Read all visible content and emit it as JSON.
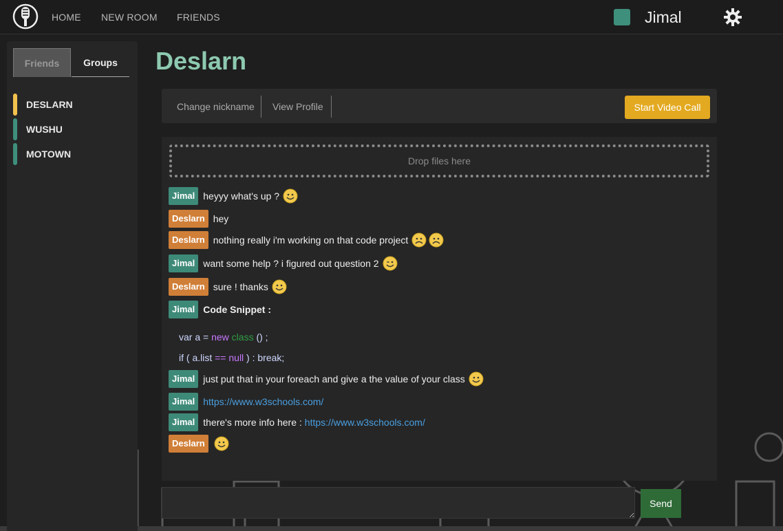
{
  "nav": {
    "home": "HOME",
    "new_room": "NEW ROOM",
    "friends": "FRIENDS",
    "username": "Jimal",
    "status_color": "#3e8f7c",
    "settings_icon": "gear-icon",
    "logo_icon": "microphone-icon"
  },
  "sidebar": {
    "tabs": [
      {
        "label": "Friends",
        "active": true
      },
      {
        "label": "Groups",
        "active": false
      }
    ],
    "friends": [
      {
        "name": "DESLARN",
        "color": "#f2c14e"
      },
      {
        "name": "WUSHU",
        "color": "#3e8f7c"
      },
      {
        "name": "MOTOWN",
        "color": "#3e8f7c"
      }
    ]
  },
  "room": {
    "title": "Deslarn",
    "toolbar": {
      "change_nickname": "Change nickname",
      "view_profile": "View Profile",
      "video_call": "Start Video Call"
    },
    "dropzone": "Drop files here",
    "send_label": "Send"
  },
  "messages": [
    {
      "sender": "Jimal",
      "text": "heyyy what's up ?",
      "emojis": [
        "smile"
      ]
    },
    {
      "sender": "Deslarn",
      "text": "hey",
      "emojis": []
    },
    {
      "sender": "Deslarn",
      "text": "nothing really i'm working on that code project",
      "emojis": [
        "frown",
        "frown"
      ]
    },
    {
      "sender": "Jimal",
      "text": "want some help ? i figured out question 2",
      "emojis": [
        "wink"
      ]
    },
    {
      "sender": "Deslarn",
      "text": "sure ! thanks",
      "emojis": [
        "smile"
      ]
    },
    {
      "sender": "Jimal",
      "text": "Code Snippet :",
      "emojis": []
    },
    {
      "sender": "Jimal",
      "text": "just put that in your foreach and give a the value of your class",
      "emojis": [
        "smile"
      ]
    },
    {
      "sender": "Jimal",
      "link": "https://www.w3schools.com/",
      "emojis": []
    },
    {
      "sender": "Jimal",
      "text": "there's more info here :",
      "link": "https://www.w3schools.com/",
      "emojis": []
    },
    {
      "sender": "Deslarn",
      "text": "",
      "emojis": [
        "smile"
      ]
    }
  ],
  "code": {
    "line1": {
      "a": "var a = ",
      "b": "new",
      "c": " ",
      "d": "class",
      "e": " () ;"
    },
    "line2": {
      "a": "if ( a.list ",
      "b": "==",
      "c": " ",
      "d": "null",
      "e": " ) : break;"
    }
  }
}
